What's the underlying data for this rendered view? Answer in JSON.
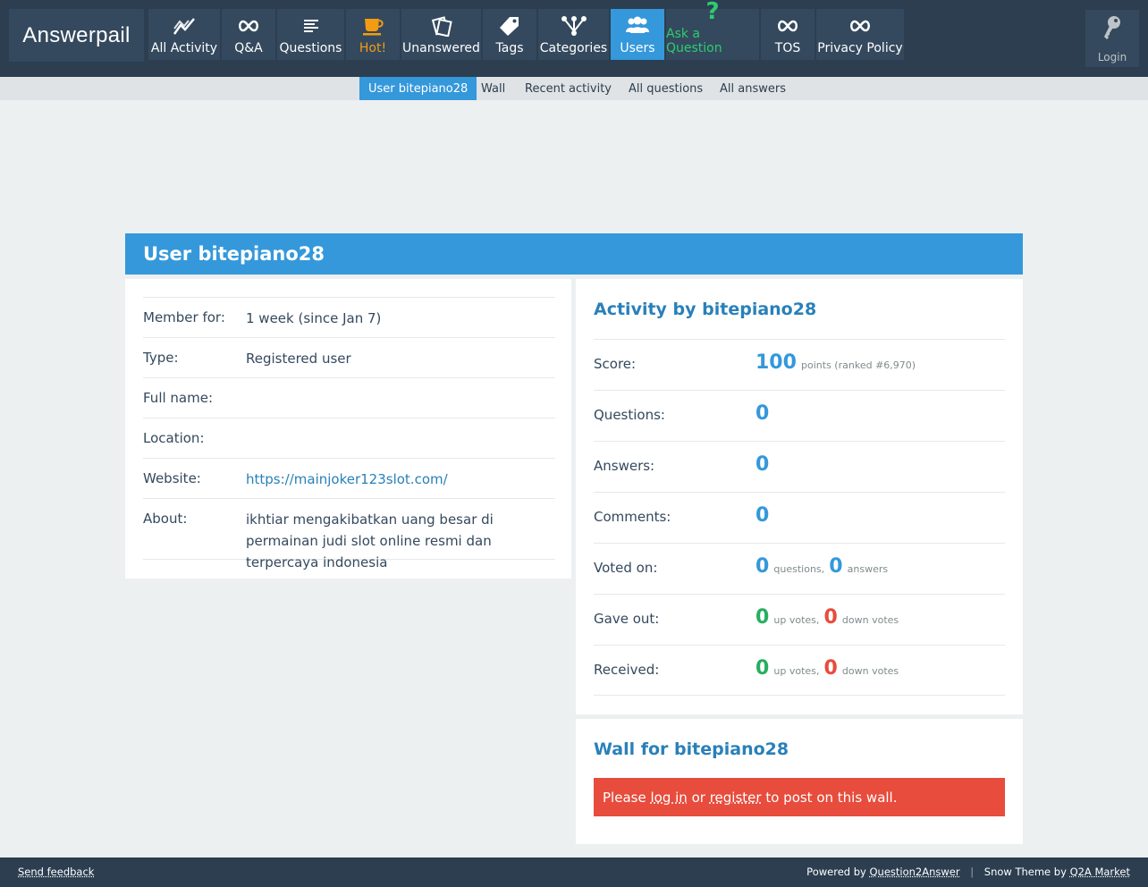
{
  "site": {
    "name": "Answerpail"
  },
  "nav": {
    "items": [
      {
        "label": "All Activity",
        "icon": "activity-icon"
      },
      {
        "label": "Q&A",
        "icon": "infinity-icon"
      },
      {
        "label": "Questions",
        "icon": "list-icon"
      },
      {
        "label": "Hot!",
        "icon": "coffee-cup-icon"
      },
      {
        "label": "Unanswered",
        "icon": "cards-icon"
      },
      {
        "label": "Tags",
        "icon": "tag-icon"
      },
      {
        "label": "Categories",
        "icon": "fork-icon"
      },
      {
        "label": "Users",
        "icon": "users-icon"
      },
      {
        "label": "Ask a Question",
        "icon": "question-mark-icon"
      },
      {
        "label": "TOS",
        "icon": "infinity-icon"
      },
      {
        "label": "Privacy Policy",
        "icon": "infinity-icon"
      }
    ],
    "login": "Login",
    "colors": {
      "active": "#3498db",
      "hot": "#f39c12",
      "ask": "#2ecc71"
    }
  },
  "subnav": {
    "items": [
      "User bitepiano28",
      "Wall",
      "Recent activity",
      "All questions",
      "All answers"
    ]
  },
  "page_title": "User bitepiano28",
  "profile": {
    "rows": [
      {
        "key": "Member for:",
        "value": "1 week (since Jan 7)"
      },
      {
        "key": "Type:",
        "value": "Registered user"
      },
      {
        "key": "Full name:",
        "value": ""
      },
      {
        "key": "Location:",
        "value": ""
      },
      {
        "key": "Website:",
        "value": "https://mainjoker123slot.com/"
      },
      {
        "key": "About:",
        "value": "ikhtiar mengakibatkan uang besar di permainan judi slot online resmi dan terpercaya indonesia"
      }
    ]
  },
  "activity": {
    "title": "Activity by bitepiano28",
    "score": {
      "label": "Score:",
      "value": "100",
      "suffix": "points (ranked #6,970)"
    },
    "questions": {
      "label": "Questions:",
      "value": "0"
    },
    "answers": {
      "label": "Answers:",
      "value": "0"
    },
    "comments": {
      "label": "Comments:",
      "value": "0"
    },
    "voted_on": {
      "label": "Voted on:",
      "questions": "0",
      "questions_label": "questions,",
      "answers": "0",
      "answers_label": "answers"
    },
    "gave_out": {
      "label": "Gave out:",
      "up": "0",
      "up_label": "up votes,",
      "down": "0",
      "down_label": "down votes"
    },
    "received": {
      "label": "Received:",
      "up": "0",
      "up_label": "up votes,",
      "down": "0",
      "down_label": "down votes"
    }
  },
  "wall": {
    "title": "Wall for bitepiano28",
    "msg_prefix": "Please",
    "login_link": "log in",
    "msg_or": "or",
    "register_link": "register",
    "msg_suffix": "to post on this wall."
  },
  "footer": {
    "feedback": "Send feedback",
    "powered_prefix": "Powered by",
    "powered_link": "Question2Answer",
    "sep": "|",
    "theme_prefix": "Snow Theme by",
    "theme_link": "Q2A Market"
  }
}
